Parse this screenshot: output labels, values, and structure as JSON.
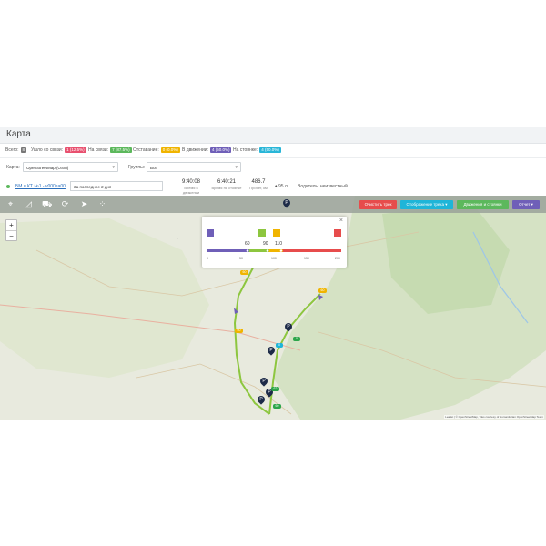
{
  "page_title": "Карта",
  "stats": {
    "total_label": "Всего:",
    "total_value": "8",
    "lost_label": "Ушло со связи:",
    "lost_value": "1 (12.5%)",
    "online_label": "На связи:",
    "online_value": "7 (87.5%)",
    "lagging_label": "Отставание:",
    "lagging_value": "0 (0.0%)",
    "moving_label": "В движении:",
    "moving_value": "4 (50.0%)",
    "parked_label": "На стоянке:",
    "parked_value": "4 (50.0%)"
  },
  "colors": {
    "lost": "#e8506f",
    "online": "#5cb85c",
    "lagging": "#f0ad4e",
    "moving": "#6f5fb8",
    "parked": "#29b6d8",
    "track": "#8dc63f"
  },
  "filters": {
    "map_label": "Карта:",
    "map_value": "OpenStreetMap (OSM)",
    "group_label": "Группы:",
    "group_value": "Все"
  },
  "vehicle": {
    "name": "БМ и КТ №1 - v000ea00",
    "period": "За последние 2 дня",
    "time_moving": "9:40:08",
    "time_moving_label": "Время в движении",
    "time_parked": "6:40:21",
    "time_parked_label": "Время на стоянке",
    "mileage": "486.7",
    "mileage_label": "Пробег, км",
    "speed": "95 л",
    "driver": "Водитель: неизвестный"
  },
  "map_buttons": {
    "clear": "Очистить трек",
    "display": "Отображение трека ▾",
    "moves": "Движения и стоянки",
    "report": "Отчет ▾"
  },
  "zoom": {
    "in": "+",
    "out": "−"
  },
  "legend": {
    "values": [
      "60",
      "90",
      "110"
    ],
    "ticks": [
      "0",
      "50",
      "100",
      "150",
      "200"
    ],
    "close": "×"
  },
  "markers": {
    "parking": "P",
    "tag_a": "60",
    "tag_b": "0",
    "tag_c": "62",
    "tag_d": "60"
  },
  "attribution": "Leaflet | © OpenStreetMap, Tiles courtesy of Humanitarian OpenStreetMap Team"
}
